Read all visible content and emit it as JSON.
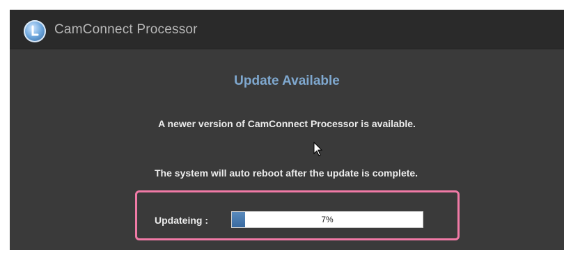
{
  "window": {
    "title": "CamConnect Processor",
    "logo_icon": "camconnect-logo-icon"
  },
  "dialog": {
    "heading": "Update Available",
    "message": "A newer version of CamConnect Processor is  available.",
    "reboot_notice": "The system will auto reboot after the update is complete.",
    "updating_label": "Updateing :",
    "progress": {
      "percent": 7,
      "text": "7%"
    }
  },
  "colors": {
    "heading": "#7fa8cf",
    "highlight": "#f07aa6",
    "progress_fill": "#4a7bb0"
  }
}
